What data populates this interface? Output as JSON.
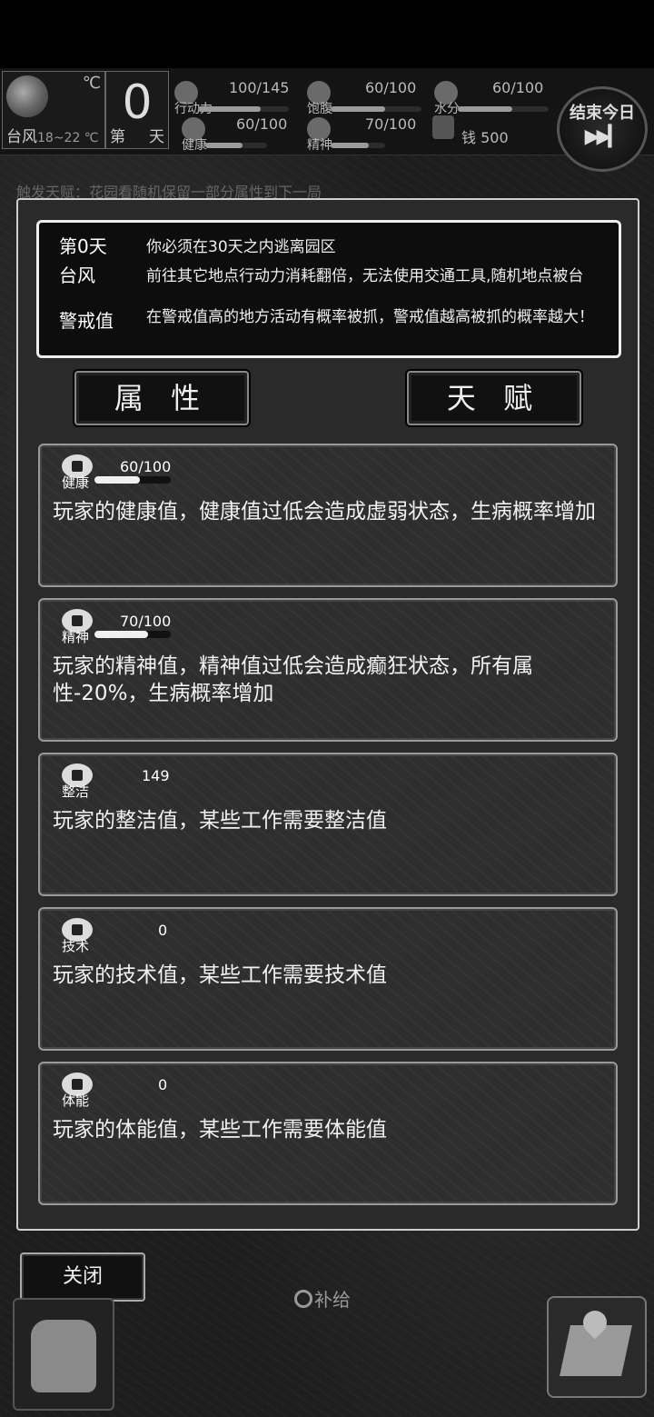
{
  "hud": {
    "temp_unit": "℃",
    "weather": "台风",
    "temp_range": "18~22 ℃",
    "day_value": "0",
    "day_prefix": "第",
    "day_suffix": "天",
    "stats": [
      {
        "name": "行动力",
        "value": "100/145",
        "fraction": 0.69
      },
      {
        "name": "饱腹",
        "value": "60/100",
        "fraction": 0.6
      },
      {
        "name": "水分",
        "value": "60/100",
        "fraction": 0.6
      },
      {
        "name": "健康",
        "value": "60/100",
        "fraction": 0.6
      },
      {
        "name": "精神",
        "value": "70/100",
        "fraction": 0.7
      }
    ],
    "money_label": "钱 500",
    "end_day_label": "结束今日",
    "end_day_icon": "fast-forward-icon"
  },
  "behind_text": "触发天赋：花园看随机保留一部分属性到下一局",
  "info": {
    "day_key": "第0天",
    "day_desc": "你必须在30天之内逃离园区",
    "weather_key": "台风",
    "weather_desc": "前往其它地点行动力消耗翻倍，无法使用交通工具,随机地点被台",
    "alert_key": "警戒值",
    "alert_desc": "在警戒值高的地方活动有概率被抓，警戒值越高被抓的概率越大！"
  },
  "tabs": {
    "attributes": "属 性",
    "talents": "天 赋"
  },
  "cards": [
    {
      "name": "健康",
      "value": "60/100",
      "fraction": 0.6,
      "has_bar": true,
      "icon": "health-icon",
      "desc": "玩家的健康值，健康值过低会造成虚弱状态，生病概率增加"
    },
    {
      "name": "精神",
      "value": "70/100",
      "fraction": 0.7,
      "has_bar": true,
      "icon": "brain-icon",
      "desc": "玩家的精神值，精神值过低会造成癫狂状态，所有属性-20%，生病概率增加"
    },
    {
      "name": "整洁",
      "value": "149",
      "has_bar": false,
      "icon": "clean-icon",
      "desc": "玩家的整洁值，某些工作需要整洁值"
    },
    {
      "name": "技术",
      "value": "0",
      "has_bar": false,
      "icon": "gear-icon",
      "desc": "玩家的技术值，某些工作需要技术值"
    },
    {
      "name": "体能",
      "value": "0",
      "has_bar": false,
      "icon": "muscle-icon",
      "desc": "玩家的体能值，某些工作需要体能值"
    }
  ],
  "close_label": "关闭",
  "supply_label": "补给",
  "bag_icon": "backpack-icon",
  "map_icon": "map-icon"
}
